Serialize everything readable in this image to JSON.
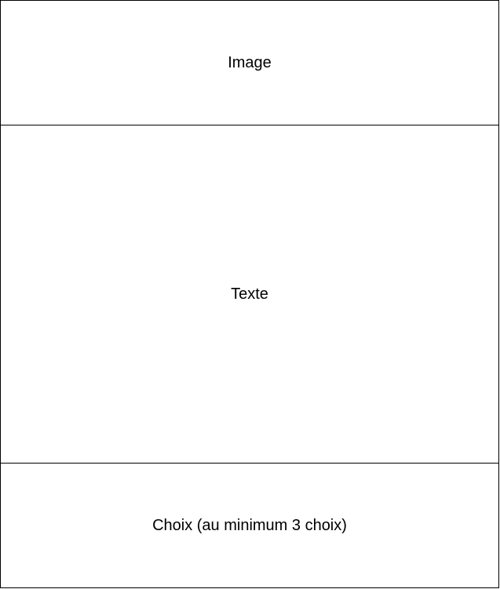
{
  "blocks": {
    "image": {
      "label": "Image"
    },
    "text": {
      "label": "Texte"
    },
    "choices": {
      "label": "Choix (au minimum 3 choix)"
    }
  },
  "colors": {
    "border": "#000000",
    "background": "#ffffff",
    "text": "#000000"
  }
}
